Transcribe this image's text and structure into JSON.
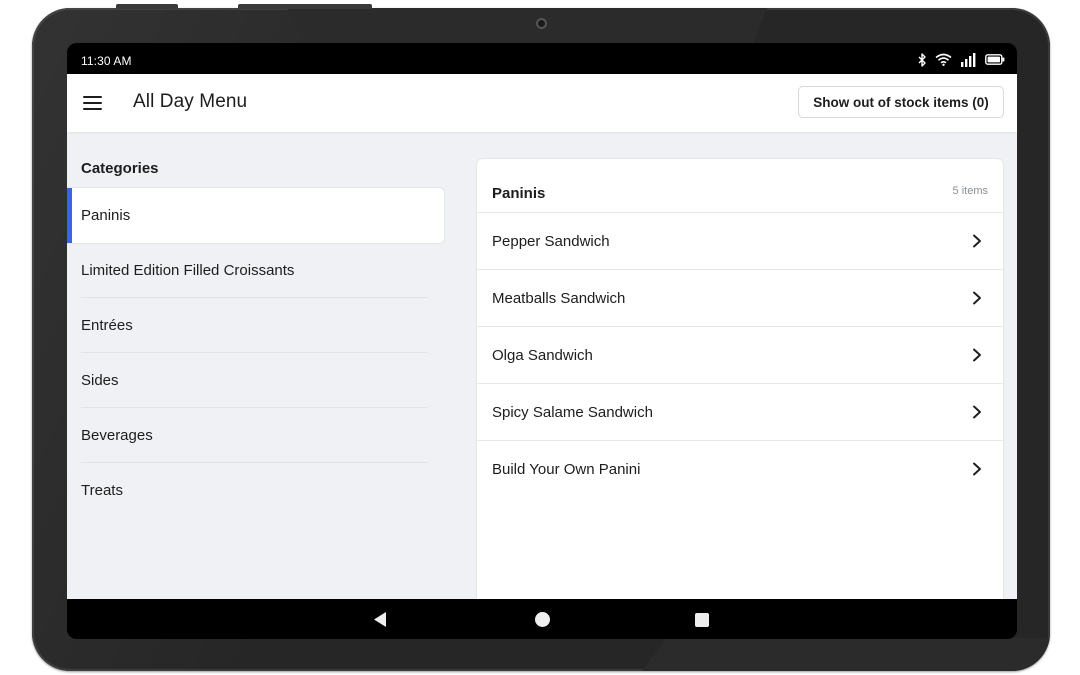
{
  "status_bar": {
    "time": "11:30 AM",
    "icons": [
      "bluetooth-icon",
      "wifi-icon",
      "signal-icon",
      "battery-icon"
    ]
  },
  "app_bar": {
    "title": "All Day Menu",
    "stock_button_label": "Show out of stock items (0)"
  },
  "categories": {
    "heading": "Categories",
    "active_index": 0,
    "items": [
      {
        "label": "Paninis"
      },
      {
        "label": "Limited Edition Filled Croissants"
      },
      {
        "label": "Entrées"
      },
      {
        "label": "Sides"
      },
      {
        "label": "Beverages"
      },
      {
        "label": "Treats"
      }
    ]
  },
  "items_panel": {
    "title": "Paninis",
    "count": "5 items",
    "items": [
      {
        "label": "Pepper Sandwich"
      },
      {
        "label": "Meatballs Sandwich"
      },
      {
        "label": "Olga Sandwich"
      },
      {
        "label": "Spicy Salame Sandwich"
      },
      {
        "label": "Build Your Own Panini"
      }
    ]
  },
  "nav_bar": {
    "icons": [
      "back-icon",
      "home-icon",
      "recents-icon"
    ]
  },
  "colors": {
    "accent": "#3d63e6",
    "background": "#eff1f4",
    "frame": "#262626"
  }
}
